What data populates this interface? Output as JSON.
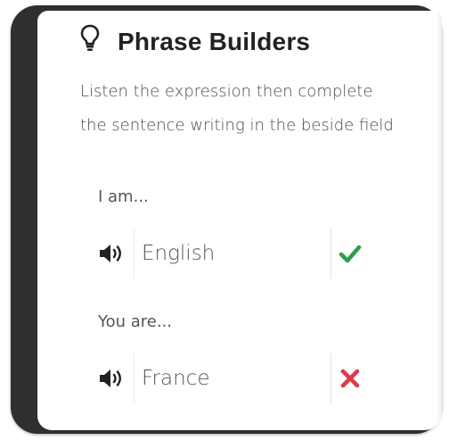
{
  "header": {
    "title": "Phrase Builders",
    "icon": "lightbulb-icon"
  },
  "instructions": {
    "line1": "Listen the expression then complete",
    "line2": "the sentence writing in the beside field"
  },
  "exercises": [
    {
      "prompt": "I am...",
      "answer": "English",
      "status": "correct",
      "status_icon": "checkmark-icon",
      "status_color": "#2e9e4a"
    },
    {
      "prompt": "You are...",
      "answer": "France",
      "status": "incorrect",
      "status_icon": "cross-icon",
      "status_color": "#e0384a"
    }
  ],
  "colors": {
    "frame": "#2f2f2f",
    "text": "#222222",
    "muted_text": "#555555"
  }
}
